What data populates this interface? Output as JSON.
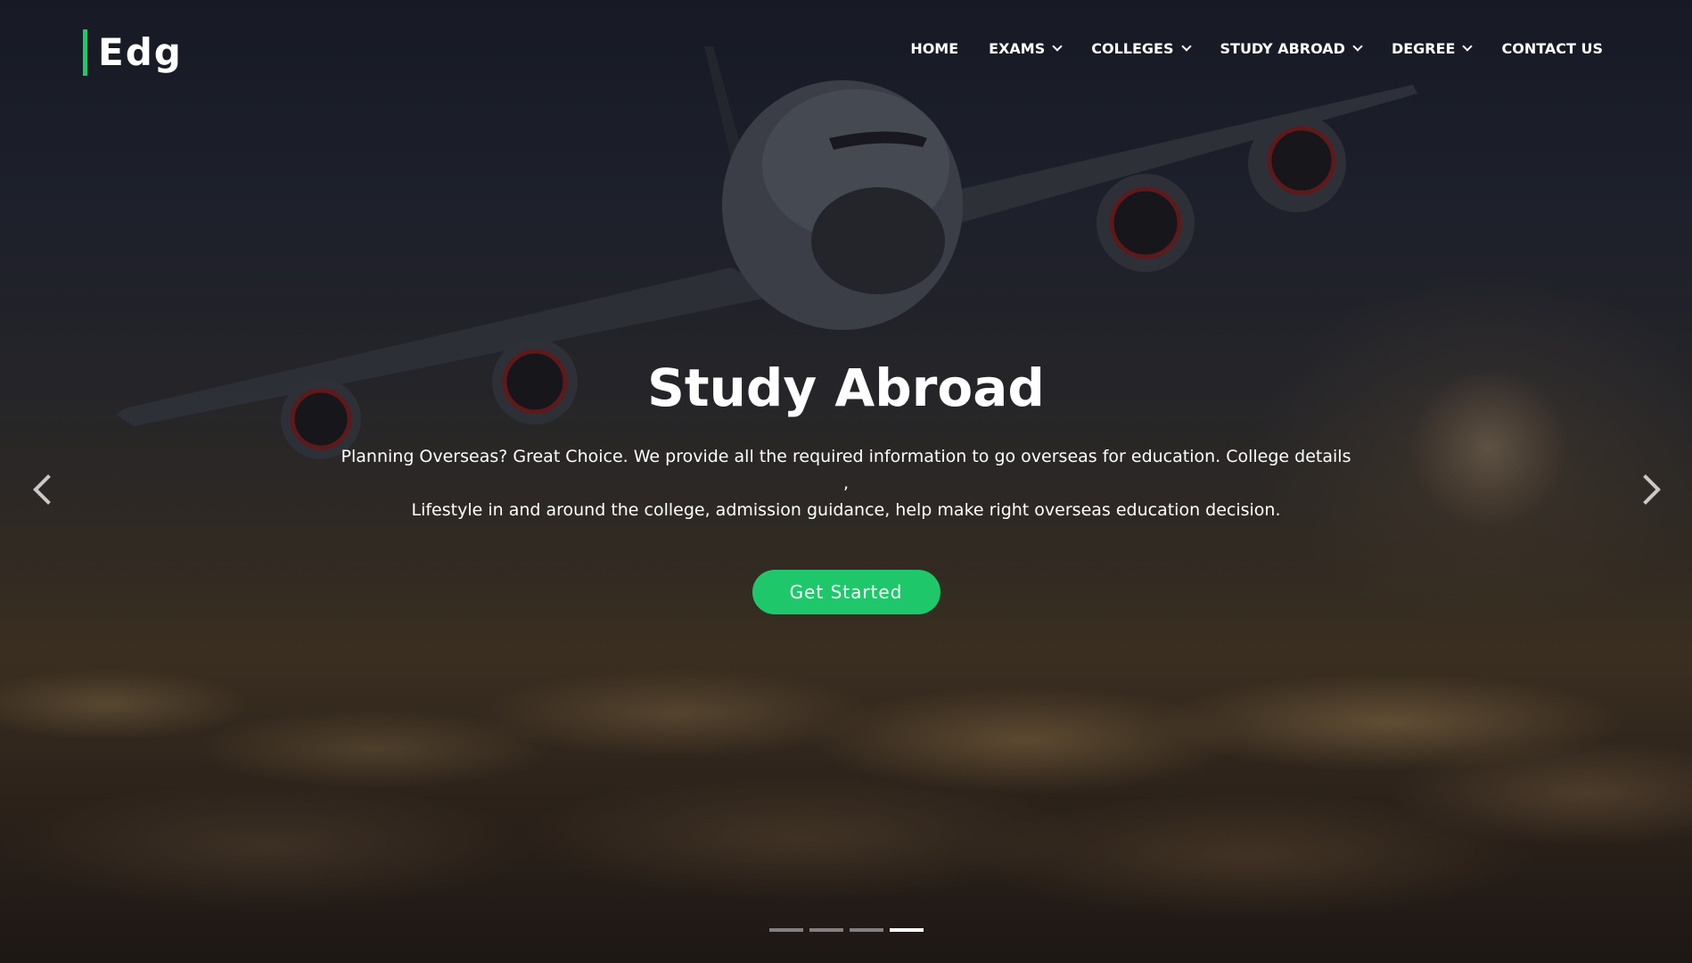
{
  "brand": {
    "logo_text": "Edg",
    "accent_color": "#1ec86a"
  },
  "nav": {
    "items": [
      {
        "label": "HOME",
        "has_dropdown": false
      },
      {
        "label": "EXAMS",
        "has_dropdown": true
      },
      {
        "label": "COLLEGES",
        "has_dropdown": true
      },
      {
        "label": "STUDY ABROAD",
        "has_dropdown": true
      },
      {
        "label": "DEGREE",
        "has_dropdown": true
      },
      {
        "label": "CONTACT US",
        "has_dropdown": false
      }
    ]
  },
  "hero": {
    "title": "Study Abroad",
    "description_line1": "Planning Overseas? Great Choice. We provide all the required information to go overseas for education. College details ,",
    "description_line2": "Lifestyle in and around the college, admission guidance, help make right overseas education decision.",
    "cta_label": "Get Started"
  },
  "carousel": {
    "prev_icon": "chevron-left-icon",
    "next_icon": "chevron-right-icon",
    "slide_count": 4,
    "active_index": 3
  }
}
